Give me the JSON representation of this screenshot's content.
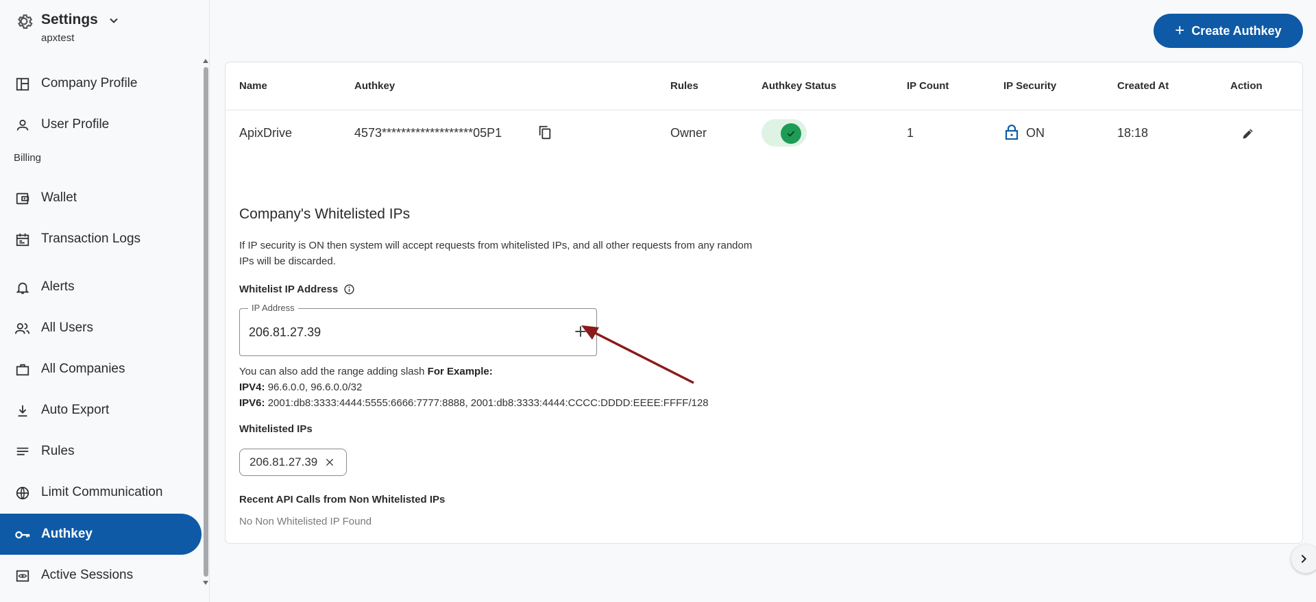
{
  "sidebar": {
    "title": "Settings",
    "subtitle": "apxtest",
    "section_billing": "Billing",
    "items": [
      {
        "label": "Company Profile",
        "icon": "layout-icon"
      },
      {
        "label": "User Profile",
        "icon": "person-icon"
      },
      {
        "label": "Wallet",
        "icon": "wallet-icon"
      },
      {
        "label": "Transaction Logs",
        "icon": "calendar-icon"
      },
      {
        "label": "Alerts",
        "icon": "bell-icon"
      },
      {
        "label": "All Users",
        "icon": "users-icon"
      },
      {
        "label": "All Companies",
        "icon": "briefcase-icon"
      },
      {
        "label": "Auto Export",
        "icon": "download-icon"
      },
      {
        "label": "Rules",
        "icon": "list-icon"
      },
      {
        "label": "Limit Communication",
        "icon": "globe-icon"
      },
      {
        "label": "Authkey",
        "icon": "key-icon",
        "active": true
      },
      {
        "label": "Active Sessions",
        "icon": "eye-icon"
      }
    ]
  },
  "header": {
    "create_label": "Create Authkey"
  },
  "table": {
    "columns": [
      "Name",
      "Authkey",
      "Rules",
      "Authkey Status",
      "IP Count",
      "IP Security",
      "Created At",
      "Action"
    ],
    "row": {
      "name": "ApixDrive",
      "authkey": "4573*******************05P1",
      "rules": "Owner",
      "status_enabled": true,
      "ip_count": "1",
      "ip_security": "ON",
      "created_at": "18:18"
    }
  },
  "whitelist": {
    "title": "Company's Whitelisted IPs",
    "description": "If IP security is ON then system will accept requests from whitelisted IPs, and all other requests from any random IPs will be discarded.",
    "field_label": "Whitelist IP Address",
    "input_legend": "IP Address",
    "input_value": "206.81.27.39",
    "hint_intro": "You can also add the range adding slash",
    "hint_example": "For Example:",
    "ipv4_label": "IPV4:",
    "ipv4_value": "96.6.0.0, 96.6.0.0/32",
    "ipv6_label": "IPV6:",
    "ipv6_value": "2001:db8:3333:4444:5555:6666:7777:8888, 2001:db8:3333:4444:CCCC:DDDD:EEEE:FFFF/128",
    "whitelisted_label": "Whitelisted IPs",
    "whitelisted_ips": [
      "206.81.27.39"
    ],
    "recent_label": "Recent API Calls from Non Whitelisted IPs",
    "recent_empty": "No Non Whitelisted IP Found"
  },
  "colors": {
    "primary": "#0e5aa7",
    "success": "#1e9b54",
    "annotation_arrow": "#8b1a1a"
  }
}
